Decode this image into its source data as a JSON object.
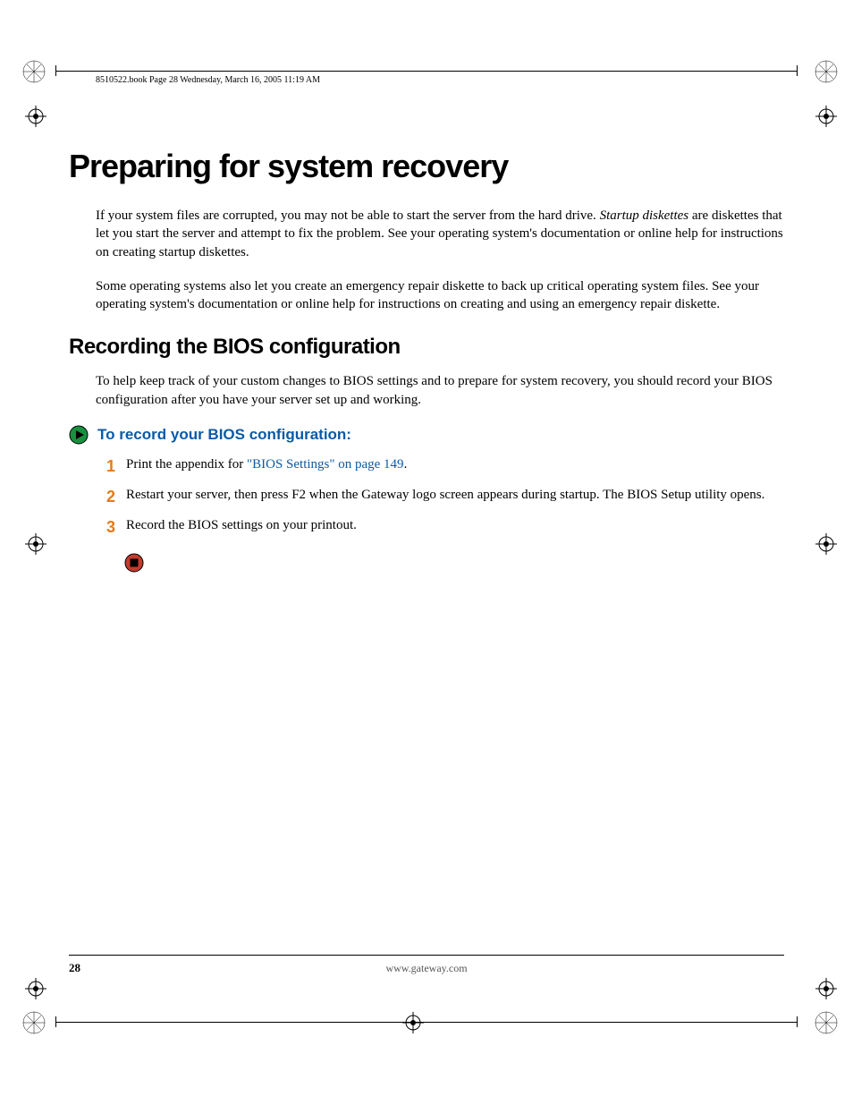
{
  "header": {
    "running_head": "8510522.book  Page 28  Wednesday, March 16, 2005  11:19 AM"
  },
  "h1": "Preparing for system recovery",
  "para1_a": "If your system files are corrupted, you may not be able to start the server from the hard drive. ",
  "para1_italic": "Startup diskettes",
  "para1_b": " are diskettes that let you start the server and attempt to fix the problem. See your operating system's documentation or online help for instructions on creating startup diskettes.",
  "para2": "Some operating systems also let you create an emergency repair diskette to back up critical operating system files. See your operating system's documentation or online help for instructions on creating and using an emergency repair diskette.",
  "h2": "Recording the BIOS configuration",
  "para3": "To help keep track of your custom changes to BIOS settings and to prepare for system recovery, you should record your BIOS configuration after you have your server set up and working.",
  "procedure_title": "To record your BIOS configuration:",
  "steps": {
    "s1_a": "Print the appendix for ",
    "s1_link": "\"BIOS Settings\" on page 149",
    "s1_b": ".",
    "s2_a": "Restart your server, then press ",
    "s2_key": "F2",
    "s2_b": " when the Gateway logo screen appears during startup. The BIOS Setup utility opens.",
    "s3": "Record the BIOS settings on your printout.",
    "n1": "1",
    "n2": "2",
    "n3": "3"
  },
  "footer": {
    "page": "28",
    "url": "www.gateway.com"
  }
}
